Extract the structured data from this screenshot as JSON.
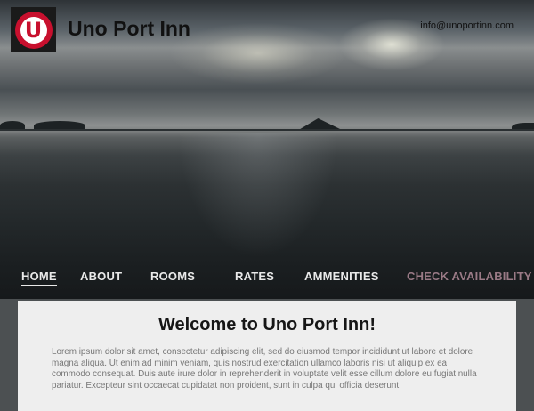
{
  "header": {
    "site_title": "Uno Port Inn",
    "logo_letter": "U",
    "email": "info@unoportinn.com"
  },
  "nav": {
    "items": [
      {
        "label": "HOME",
        "active": true
      },
      {
        "label": "ABOUT",
        "active": false
      },
      {
        "label": "ROOMS",
        "active": false
      },
      {
        "label": "RATES",
        "active": false
      },
      {
        "label": "AMMENITIES",
        "active": false
      },
      {
        "label": "CHECK AVAILABILITY",
        "active": false
      }
    ]
  },
  "main": {
    "heading": "Welcome to Uno Port Inn!",
    "body": "Lorem ipsum dolor sit amet, consectetur adipiscing elit, sed do eiusmod tempor incididunt ut labore et dolore magna aliqua. Ut enim ad minim veniam, quis nostrud exercitation ullamco laboris nisi ut aliquip ex ea commodo consequat. Duis aute irure dolor in reprehenderit in voluptate velit esse cillum dolore eu fugiat nulla pariatur. Excepteur sint occaecat cupidatat non proident, sunt in culpa qui officia deserunt"
  },
  "colors": {
    "logo_red": "#c8102e",
    "nav_text": "#e9e9e9",
    "cta_text": "#9a7a86"
  },
  "icons": {
    "logo": "uno-logo-icon"
  }
}
